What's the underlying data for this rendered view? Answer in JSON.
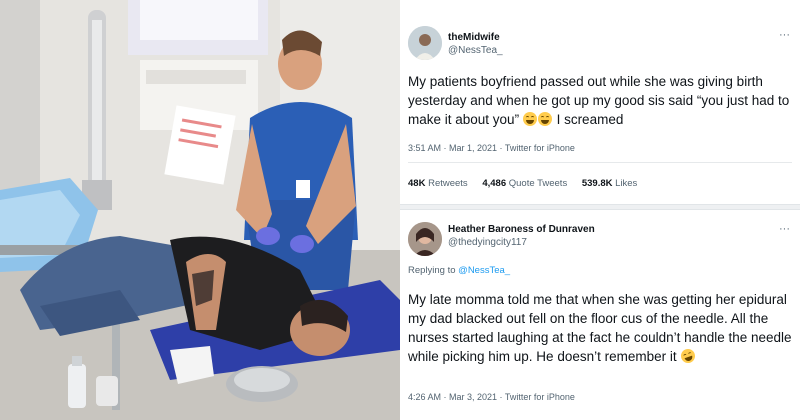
{
  "photo": {
    "description_icon": "hospital-room-photo"
  },
  "tweets": [
    {
      "name": "theMidwife",
      "handle": "@NessTea_",
      "more_icon": "more-icon",
      "text_before_emoji": "My patients boyfriend passed out while she was giving birth yesterday and when he got up my good sis said “you just had to make it about you” ",
      "emoji": "laughing-tears-emoji",
      "emoji_count": 2,
      "text_after_emoji": " I screamed",
      "meta": "3:51 AM · Mar 1, 2021 · Twitter for iPhone",
      "stats": {
        "retweets_value": "48K",
        "retweets_label": "Retweets",
        "quotes_value": "4,486",
        "quotes_label": "Quote Tweets",
        "likes_value": "539.8K",
        "likes_label": "Likes"
      }
    },
    {
      "name": "Heather Baroness of Dunraven",
      "handle": "@thedyingcity117",
      "more_icon": "more-icon",
      "replying_prefix": "Replying to ",
      "replying_to": "@NessTea_",
      "text_before_emoji": "My late momma told me that when she was getting her epidural my dad blacked out fell on the floor cus of the needle. All the nurses started laughing at the fact he couldn’t handle the needle while picking him up. He doesn’t remember it ",
      "emoji": "rolling-laughing-emoji",
      "meta": "4:26 AM · Mar 3, 2021 · Twitter for iPhone"
    }
  ]
}
